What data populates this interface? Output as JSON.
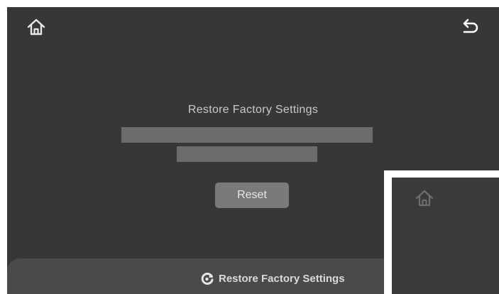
{
  "screen": {
    "title": "Restore Factory Settings",
    "reset_label": "Reset",
    "bottom_label": "Restore Factory Settings"
  },
  "icons": {
    "home": "home-icon",
    "back": "back-arrow-icon",
    "restore": "restore-icon"
  },
  "colors": {
    "background": "#373737",
    "placeholder_bar": "#6c6c6c",
    "button": "#7a7a7a",
    "bottom_panel": "#4a4a4a",
    "text": "#c9c9c9"
  }
}
